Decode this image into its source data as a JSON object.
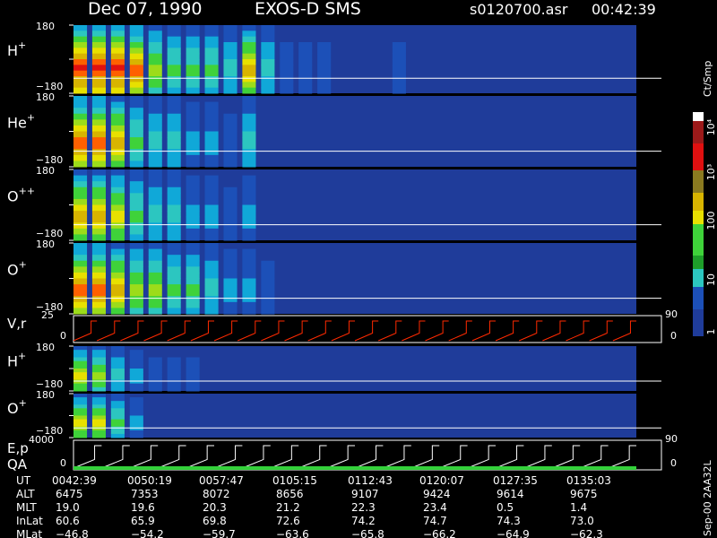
{
  "header": {
    "date": "Dec 07, 1990",
    "mission": "EXOS-D SMS",
    "file": "s0120700.asr",
    "time": "00:42:39"
  },
  "colorbar": {
    "unit": "Ct/Smp",
    "ticks": [
      "10⁴",
      "10³",
      "100",
      "10",
      "1"
    ]
  },
  "side_label": "Sep-00 2AA32L",
  "colors": {
    "background": "#000000",
    "plot_background": "#1f3c9a",
    "white": "#ffffff",
    "red": "#ff2a00",
    "green": "#33d13a"
  },
  "chart_data": {
    "type": "heatmap",
    "panels": [
      {
        "label": "H",
        "sup": "+",
        "ymax": "180",
        "ymin": "−180",
        "intensity": [
          9,
          9,
          9,
          8,
          5,
          4,
          4,
          4,
          3,
          7,
          3,
          1,
          1,
          1,
          0,
          0,
          0,
          1,
          0,
          0,
          0,
          0,
          0,
          0,
          0,
          0,
          0,
          0,
          0,
          0
        ]
      },
      {
        "label": "He",
        "sup": "+",
        "ymax": "180",
        "ymin": "−180",
        "intensity": [
          8,
          8,
          7,
          4,
          3,
          3,
          2,
          2,
          1,
          3,
          0,
          0,
          0,
          0,
          0,
          0,
          0,
          0,
          0,
          0,
          0,
          0,
          0,
          0,
          0,
          0,
          0,
          0,
          0,
          0
        ]
      },
      {
        "label": "O",
        "sup": "++",
        "ymax": "180",
        "ymin": "−180",
        "intensity": [
          7,
          7,
          6,
          4,
          3,
          3,
          2,
          2,
          1,
          2,
          0,
          0,
          0,
          0,
          0,
          0,
          0,
          0,
          0,
          0,
          0,
          0,
          0,
          0,
          0,
          0,
          0,
          0,
          0,
          0
        ]
      },
      {
        "label": "O",
        "sup": "+",
        "ymax": "180",
        "ymin": "−180",
        "intensity": [
          8,
          8,
          7,
          5,
          5,
          4,
          4,
          3,
          2,
          2,
          1,
          0,
          0,
          0,
          0,
          0,
          0,
          0,
          0,
          0,
          0,
          0,
          0,
          0,
          0,
          0,
          0,
          0,
          0,
          0
        ]
      },
      {
        "label": "H",
        "sup": "+",
        "ymax": "180",
        "ymin": "−180",
        "intensity": [
          6,
          5,
          3,
          2,
          1,
          1,
          1,
          0,
          0,
          0,
          0,
          0,
          0,
          0,
          0,
          0,
          0,
          0,
          0,
          0,
          0,
          0,
          0,
          0,
          0,
          0,
          0,
          0,
          0,
          0
        ]
      },
      {
        "label": "O",
        "sup": "+",
        "ymax": "180",
        "ymin": "−180",
        "intensity": [
          6,
          6,
          4,
          2,
          0,
          0,
          0,
          0,
          0,
          0,
          0,
          0,
          0,
          0,
          0,
          0,
          0,
          0,
          0,
          0,
          0,
          0,
          0,
          0,
          0,
          0,
          0,
          0,
          0,
          0
        ]
      }
    ],
    "line_panels": [
      {
        "label": "V,r",
        "ymax": "25",
        "ymin": "0",
        "right_top": "90",
        "right_bottom": "0",
        "color": "#ff2a00",
        "ramps": 24
      },
      {
        "label": "E,p",
        "label2": "QA",
        "ymax": "4000",
        "ymin": "0",
        "right_top": "90",
        "right_bottom": "0",
        "color": "#ffffff",
        "ramps": 20
      }
    ],
    "time_axis": {
      "label": "UT",
      "ticks": [
        "0042:39",
        "0050:19",
        "0057:47",
        "0105:15",
        "0112:43",
        "0120:07",
        "0127:35",
        "0135:03"
      ]
    },
    "ephemeris": [
      {
        "label": "ALT",
        "values": [
          "6475",
          "7353",
          "8072",
          "8656",
          "9107",
          "9424",
          "9614",
          "9675"
        ]
      },
      {
        "label": "MLT",
        "values": [
          "19.0",
          "19.6",
          "20.3",
          "21.2",
          "22.3",
          "23.4",
          "0.5",
          "1.4"
        ]
      },
      {
        "label": "InLat",
        "values": [
          "60.6",
          "65.9",
          "69.8",
          "72.6",
          "74.2",
          "74.7",
          "74.3",
          "73.0"
        ]
      },
      {
        "label": "MLat",
        "values": [
          "−46.8",
          "−54.2",
          "−59.7",
          "−63.6",
          "−65.8",
          "−66.2",
          "−64.9",
          "−62.3"
        ]
      }
    ]
  }
}
